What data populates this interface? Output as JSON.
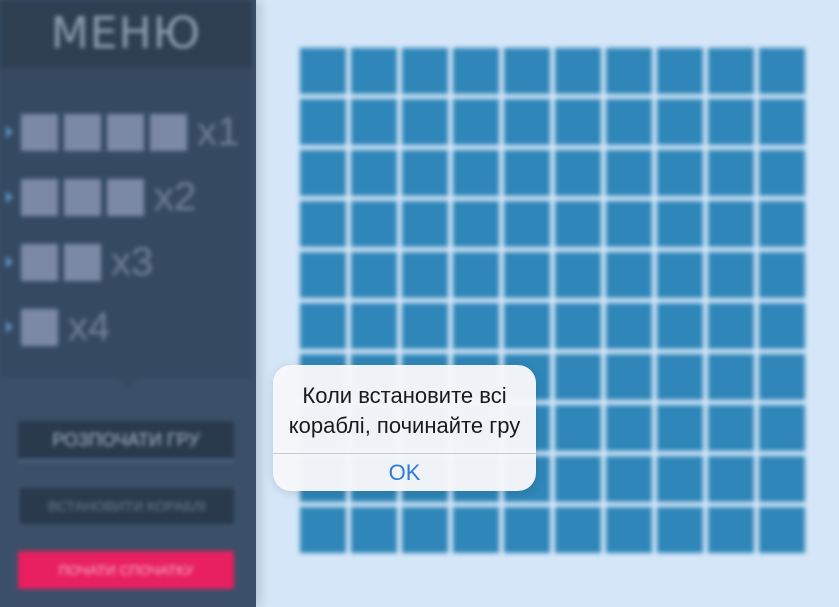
{
  "sidebar": {
    "menu_title": "МЕНЮ",
    "ships": [
      {
        "cells": 4,
        "count": "x1"
      },
      {
        "cells": 3,
        "count": "x2"
      },
      {
        "cells": 2,
        "count": "x3"
      },
      {
        "cells": 1,
        "count": "x4"
      }
    ],
    "buttons": {
      "start": "РОЗПОЧАТИ ГРУ",
      "place": "ВСТАНОВИТИ КОРАБЛІ",
      "restart": "ПОЧАТИ СПОЧАТКУ"
    }
  },
  "board": {
    "rows": 10,
    "cols": 10
  },
  "dialog": {
    "line1": "Коли встановите всі",
    "line2": "кораблі, починайте гру",
    "ok": "OK"
  },
  "colors": {
    "page_bg": "#d4e6f8",
    "sidebar_bg": "#3b5068",
    "board_cell": "#2f86b8",
    "restart_button": "#e82060",
    "dialog_link": "#2f7ad8"
  }
}
